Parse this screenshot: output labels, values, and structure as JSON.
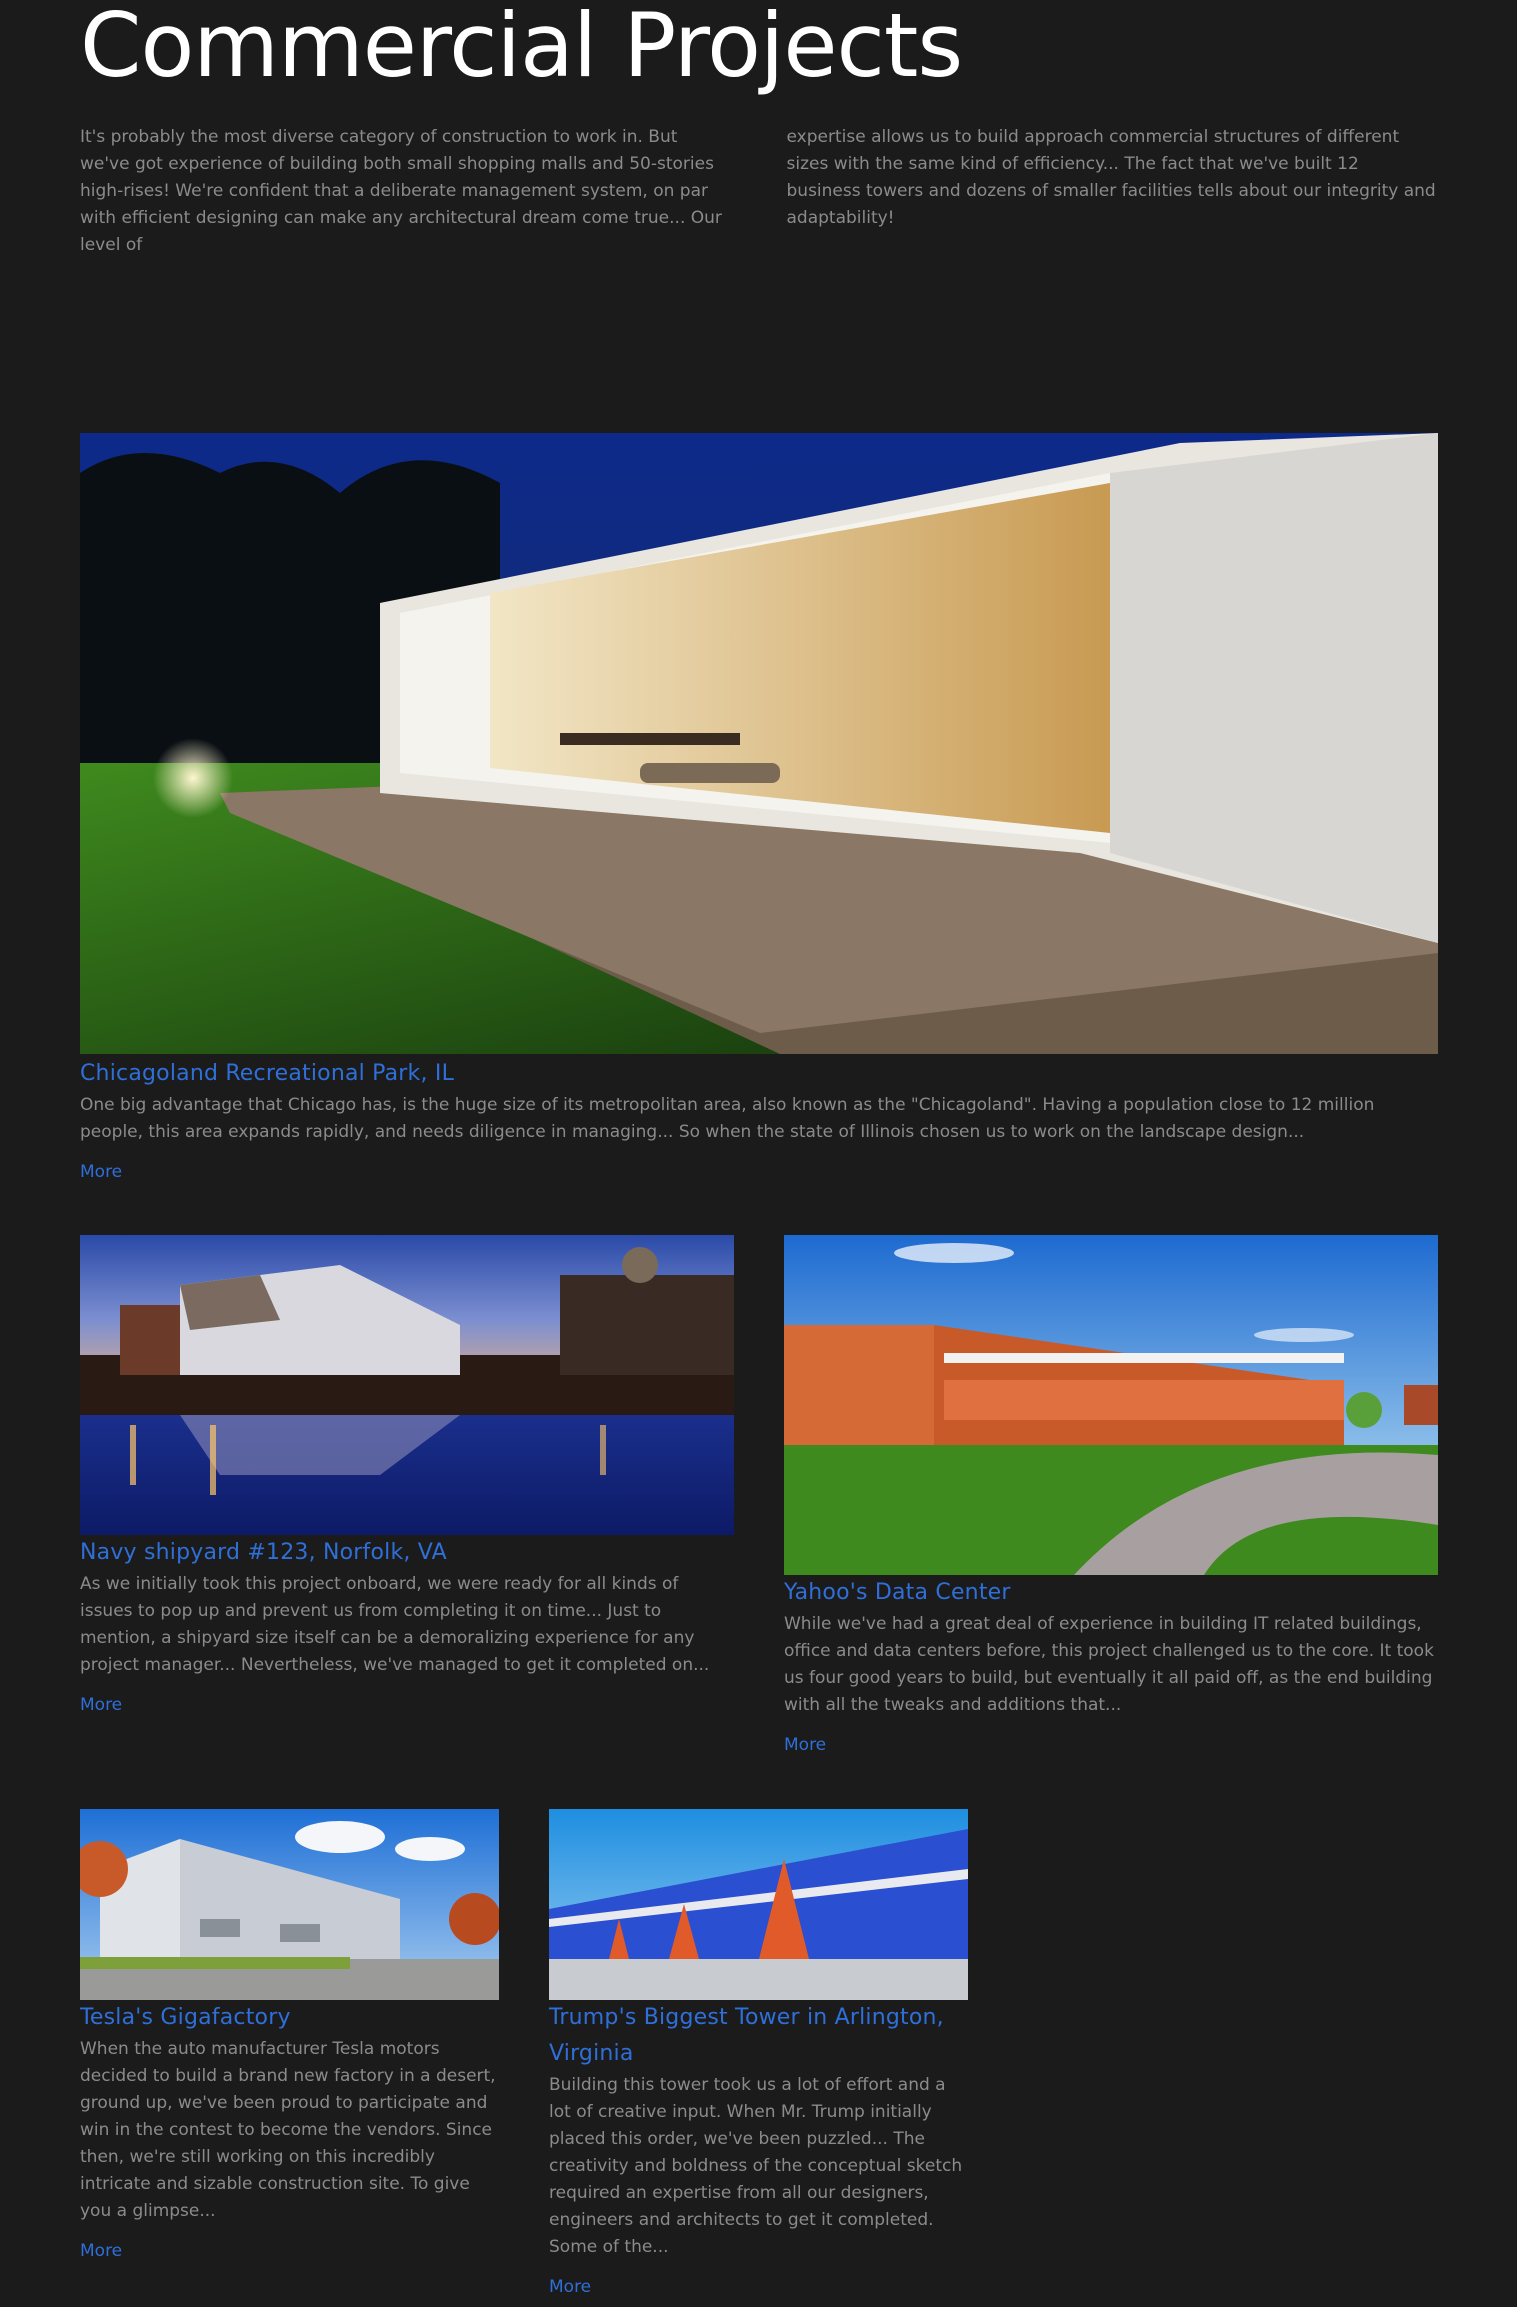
{
  "page": {
    "title": "Commercial Projects",
    "intro_left": "It's probably the most diverse category of construction to work in. But we've got experience of building both small shopping malls and 50-stories high-rises! We're confident that a deliberate management system, on par with efficient designing can make any architectural dream come true... Our level of",
    "intro_right": "expertise allows us to build approach commercial structures of different sizes with the same kind of efficiency... The fact that we've built 12 business towers and dozens of smaller facilities tells about our integrity and adaptability!"
  },
  "projects": [
    {
      "title": "Chicagoland Recreational Park, IL",
      "text": "One big advantage that Chicago has, is the huge size of its metropolitan area, also known as the \"Chicagoland\". Having a population close to 12 million people, this area expands rapidly, and needs diligence in managing... So when the state of Illinois chosen us to work on the landscape design...",
      "more": "More"
    },
    {
      "title": "Navy shipyard #123, Norfolk, VA",
      "text": "As we initially took this project onboard, we were ready for all kinds of issues to pop up and prevent us from completing it on time... Just to mention, a shipyard size itself can be a demoralizing experience for any project manager... Nevertheless, we've managed to get it completed on...",
      "more": "More"
    },
    {
      "title": "Yahoo's Data Center",
      "text": "While we've had a great deal of experience in building IT related buildings, office and data centers before, this project challenged us to the core. It took us four good years to build, but eventually it all paid off, as the end building with all the tweaks and additions that...",
      "more": "More"
    },
    {
      "title": "Tesla's Gigafactory",
      "text": "When the auto manufacturer Tesla motors decided to build a brand new factory in a desert, ground up, we've been proud to participate and win in the contest to become the vendors. Since then, we're still working on this incredibly intricate and sizable construction site. To give you a glimpse...",
      "more": "More"
    },
    {
      "title": "Trump's Biggest Tower in Arlington, Virginia",
      "text": "Building this tower took us a lot of effort and a lot of creative input. When Mr. Trump initially placed this order, we've been puzzled... The creativity and boldness of the conceptual sketch required an expertise from all our designers, engineers and architects to get it completed. Some of the...",
      "more": "More"
    }
  ],
  "colors": {
    "background": "#1b1b1c",
    "accent": "#2f6fd8",
    "body_text": "#8b8b8b",
    "title": "#ffffff"
  }
}
